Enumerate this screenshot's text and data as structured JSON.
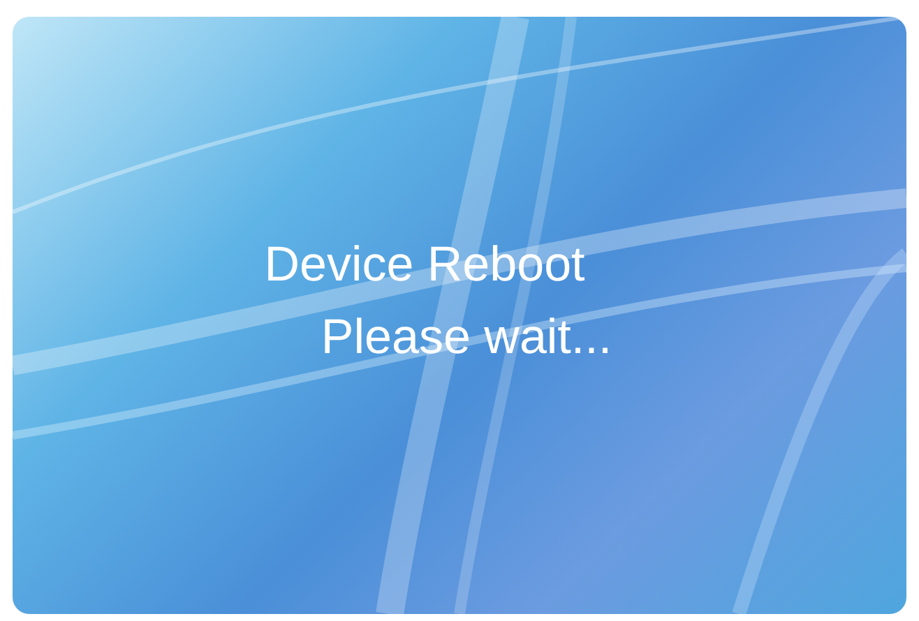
{
  "screen": {
    "title": "Device Reboot",
    "message": "Please wait..."
  }
}
